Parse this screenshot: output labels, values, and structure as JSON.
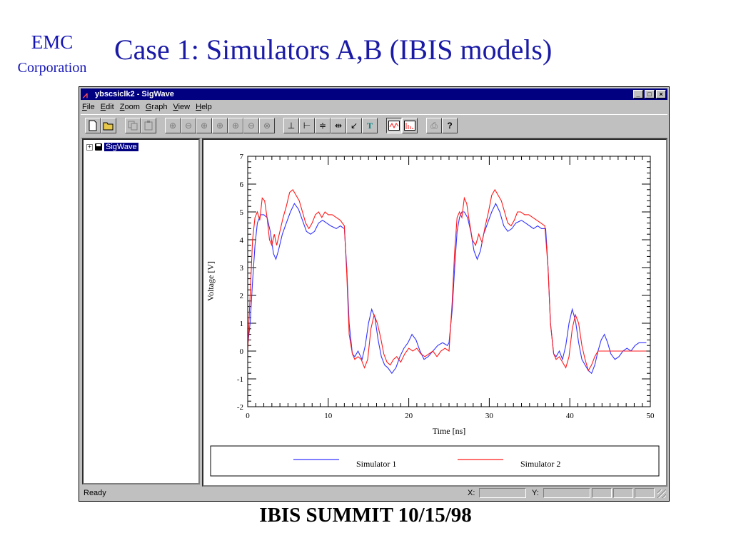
{
  "slide": {
    "logo_line1": "EMC",
    "logo_line2": "Corporation",
    "title": "Case 1: Simulators A,B (IBIS models)",
    "footer": "IBIS SUMMIT 10/15/98"
  },
  "window": {
    "title": "ybscsiclk2 - SigWave",
    "controls": {
      "minimize": "_",
      "maximize": "□",
      "close": "×"
    },
    "menu": [
      "File",
      "Edit",
      "Zoom",
      "Graph",
      "View",
      "Help"
    ],
    "toolbar_icons": [
      "new-icon",
      "open-icon",
      "copy-icon",
      "paste-icon",
      "zoom-in-icon",
      "zoom-out-icon",
      "zoom-x-icon",
      "zoom-y-icon",
      "zoom-fit-icon",
      "zoom-prev-icon",
      "zoom-box-icon",
      "marker-bottom-icon",
      "marker-left-icon",
      "marker-vertical-icon",
      "marker-horizontal-icon",
      "marker-diagonal-icon",
      "text-icon",
      "waveform-icon",
      "spectrum-icon",
      "print-icon",
      "help-icon"
    ],
    "tree": {
      "expander": "+",
      "root_label": "SigWave"
    },
    "status": {
      "ready": "Ready",
      "x_label": "X:",
      "y_label": "Y:"
    },
    "colors": {
      "titlebar": "#000080",
      "face": "#c0c0c0",
      "series1": "#3333ff",
      "series2": "#ff1a1a"
    }
  },
  "chart_data": {
    "type": "line",
    "xlabel": "Time [ns]",
    "ylabel": "Voltage [V]",
    "xlim": [
      0,
      50
    ],
    "ylim": [
      -2,
      7
    ],
    "xticks": [
      0,
      10,
      20,
      30,
      40,
      50
    ],
    "yticks": [
      -2,
      -1,
      0,
      1,
      2,
      3,
      4,
      5,
      6,
      7
    ],
    "legend_position": "bottom",
    "series": [
      {
        "name": "Simulator 1",
        "color": "#3333ff",
        "x": [
          0,
          0.3,
          0.6,
          0.9,
          1.2,
          1.6,
          2.0,
          2.4,
          2.8,
          3.2,
          3.5,
          3.8,
          4.3,
          4.8,
          5.3,
          5.8,
          6.3,
          6.8,
          7.3,
          7.8,
          8.3,
          8.8,
          9.3,
          9.8,
          10.3,
          11.0,
          11.5,
          12.0,
          12.3,
          12.6,
          13.0,
          13.3,
          13.7,
          14.2,
          14.6,
          15.0,
          15.4,
          15.8,
          16.2,
          16.6,
          17.0,
          17.4,
          17.9,
          18.4,
          18.9,
          19.4,
          19.9,
          20.4,
          20.9,
          21.4,
          21.9,
          22.4,
          23.0,
          23.6,
          24.2,
          24.8,
          25.0,
          25.4,
          25.7,
          26.0,
          26.3,
          26.6,
          26.9,
          27.3,
          27.7,
          28.1,
          28.5,
          28.9,
          29.3,
          29.8,
          30.3,
          30.8,
          31.3,
          31.8,
          32.3,
          32.8,
          33.3,
          34.0,
          34.5,
          35.0,
          35.5,
          36.0,
          36.5,
          37.0,
          37.3,
          37.6,
          38.0,
          38.3,
          38.7,
          39.1,
          39.5,
          39.9,
          40.3,
          40.7,
          41.1,
          41.5,
          41.9,
          42.3,
          42.7,
          43.1,
          43.5,
          43.9,
          44.3,
          44.7,
          45.1,
          45.6,
          46.1,
          46.6,
          47.1,
          47.6,
          48.1,
          48.6,
          49.1,
          49.5
        ],
        "y": [
          0.2,
          1.0,
          2.5,
          3.8,
          4.6,
          4.9,
          4.9,
          4.8,
          4.3,
          3.5,
          3.3,
          3.6,
          4.2,
          4.6,
          5.0,
          5.3,
          5.1,
          4.7,
          4.3,
          4.2,
          4.3,
          4.6,
          4.7,
          4.6,
          4.5,
          4.4,
          4.5,
          4.4,
          3.0,
          1.0,
          -0.1,
          -0.2,
          0.0,
          -0.3,
          0.2,
          1.0,
          1.5,
          1.2,
          0.4,
          -0.2,
          -0.5,
          -0.6,
          -0.8,
          -0.6,
          -0.2,
          0.1,
          0.3,
          0.6,
          0.4,
          0.0,
          -0.3,
          -0.2,
          0.0,
          0.2,
          0.3,
          0.2,
          0.3,
          1.5,
          3.0,
          4.3,
          4.8,
          5.0,
          5.0,
          4.8,
          4.3,
          3.6,
          3.3,
          3.6,
          4.2,
          4.6,
          5.0,
          5.3,
          5.0,
          4.5,
          4.3,
          4.4,
          4.6,
          4.7,
          4.6,
          4.5,
          4.4,
          4.5,
          4.4,
          4.4,
          3.0,
          1.0,
          -0.1,
          -0.2,
          0.0,
          -0.3,
          0.2,
          1.0,
          1.5,
          1.1,
          0.3,
          -0.3,
          -0.5,
          -0.7,
          -0.8,
          -0.5,
          0.0,
          0.4,
          0.6,
          0.3,
          -0.1,
          -0.3,
          -0.2,
          0.0,
          0.1,
          0.0,
          0.2,
          0.3,
          0.3,
          0.3
        ]
      },
      {
        "name": "Simulator 2",
        "color": "#ff1a1a",
        "x": [
          0,
          0.3,
          0.6,
          0.9,
          1.2,
          1.5,
          1.8,
          2.1,
          2.4,
          2.7,
          3.0,
          3.3,
          3.6,
          4.0,
          4.4,
          4.8,
          5.2,
          5.6,
          6.0,
          6.4,
          6.8,
          7.2,
          7.6,
          8.0,
          8.4,
          8.8,
          9.2,
          9.6,
          10.0,
          10.5,
          11.0,
          11.5,
          12.0,
          12.3,
          12.6,
          13.0,
          13.3,
          13.7,
          14.1,
          14.5,
          14.9,
          15.3,
          15.7,
          16.1,
          16.5,
          16.9,
          17.3,
          17.7,
          18.1,
          18.5,
          19.0,
          19.5,
          20.0,
          20.5,
          21.0,
          21.5,
          22.0,
          22.5,
          23.0,
          23.5,
          24.0,
          24.5,
          25.0,
          25.4,
          25.7,
          26.0,
          26.3,
          26.6,
          26.9,
          27.2,
          27.5,
          27.9,
          28.3,
          28.7,
          29.1,
          29.5,
          29.9,
          30.3,
          30.7,
          31.1,
          31.5,
          31.9,
          32.3,
          32.7,
          33.1,
          33.5,
          33.9,
          34.4,
          34.9,
          35.4,
          35.9,
          36.4,
          36.9,
          37.3,
          37.6,
          38.0,
          38.3,
          38.7,
          39.1,
          39.5,
          39.9,
          40.3,
          40.7,
          41.1,
          41.5,
          41.9,
          42.3,
          42.7,
          43.1,
          43.5,
          43.9,
          44.3,
          44.7,
          45.1,
          45.5,
          46.0,
          47.0,
          48.0,
          49.0,
          49.5
        ],
        "y": [
          0.0,
          2.0,
          4.0,
          4.8,
          5.0,
          4.7,
          5.5,
          5.4,
          4.8,
          4.0,
          3.8,
          4.2,
          3.8,
          4.3,
          4.8,
          5.2,
          5.7,
          5.8,
          5.6,
          5.4,
          5.0,
          4.6,
          4.4,
          4.6,
          4.9,
          5.0,
          4.8,
          5.0,
          4.9,
          4.9,
          4.8,
          4.7,
          4.5,
          2.8,
          0.6,
          -0.1,
          -0.3,
          -0.2,
          -0.3,
          -0.6,
          -0.3,
          0.8,
          1.3,
          1.0,
          0.5,
          -0.1,
          -0.4,
          -0.5,
          -0.3,
          -0.2,
          -0.4,
          -0.1,
          0.1,
          0.0,
          0.1,
          -0.1,
          -0.2,
          -0.1,
          0.0,
          -0.2,
          0.0,
          0.1,
          0.0,
          1.8,
          3.6,
          4.8,
          5.0,
          4.8,
          5.5,
          5.3,
          4.7,
          4.0,
          3.8,
          4.2,
          3.9,
          4.5,
          5.0,
          5.6,
          5.8,
          5.6,
          5.4,
          5.0,
          4.6,
          4.5,
          4.7,
          5.0,
          5.0,
          4.9,
          4.9,
          4.8,
          4.7,
          4.6,
          4.5,
          3.0,
          1.0,
          -0.1,
          -0.3,
          -0.2,
          -0.4,
          -0.6,
          -0.2,
          0.8,
          1.3,
          1.0,
          0.2,
          -0.3,
          -0.7,
          -0.5,
          -0.2,
          0.0,
          0.0,
          0.0,
          0.0,
          0.0,
          0.0,
          0.0,
          0.0,
          0.0,
          0.0,
          0.0
        ]
      }
    ]
  }
}
